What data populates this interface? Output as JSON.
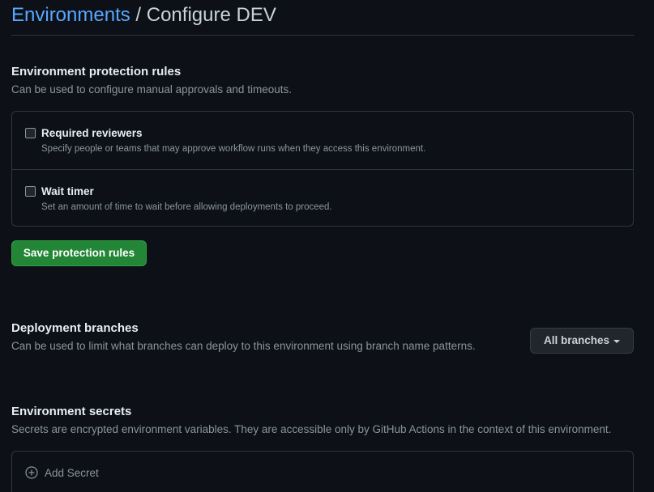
{
  "header": {
    "breadcrumb_link": "Environments",
    "separator": "/",
    "current": "Configure DEV"
  },
  "protection": {
    "title": "Environment protection rules",
    "description": "Can be used to configure manual approvals and timeouts.",
    "rules": [
      {
        "label": "Required reviewers",
        "description": "Specify people or teams that may approve workflow runs when they access this environment.",
        "checked": false
      },
      {
        "label": "Wait timer",
        "description": "Set an amount of time to wait before allowing deployments to proceed.",
        "checked": false
      }
    ],
    "save_label": "Save protection rules"
  },
  "branches": {
    "title": "Deployment branches",
    "description": "Can be used to limit what branches can deploy to this environment using branch name patterns.",
    "selected": "All branches"
  },
  "secrets": {
    "title": "Environment secrets",
    "description": "Secrets are encrypted environment variables. They are accessible only by GitHub Actions in the context of this environment.",
    "add_label": "Add Secret"
  },
  "colors": {
    "background": "#0d1117",
    "link": "#58a6ff",
    "primary_button": "#238636",
    "border": "#30363d",
    "muted_text": "#8b949e"
  },
  "icons": {
    "caret": "triangle-down-icon",
    "add": "plus-circle-icon"
  }
}
